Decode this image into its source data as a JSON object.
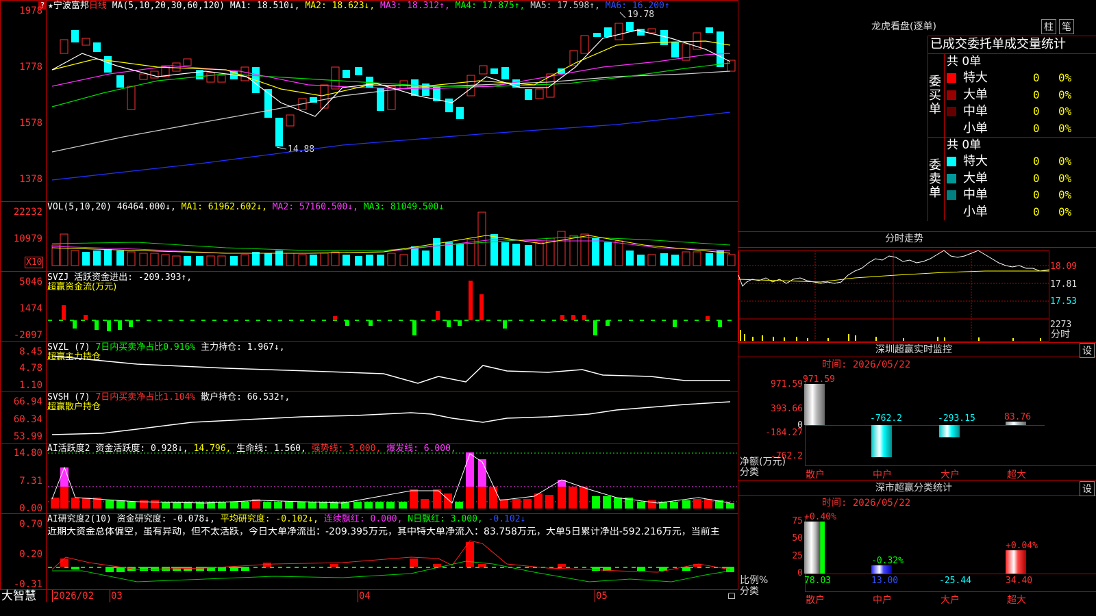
{
  "app": {
    "brand": "大智慧"
  },
  "main": {
    "question_icon": "?",
    "star": "★",
    "stock_name": "宁波富邦",
    "period": "日线",
    "ma_legend": {
      "params": "MA(5,10,20,30,60,120)",
      "ma1": "MA1: 18.510↓,",
      "ma2": "MA2: 18.623↓,",
      "ma3": "MA3: 18.312↑,",
      "ma4": "MA4: 17.875↑,",
      "ma5": "MA5: 17.598↑,",
      "ma6": "MA6: 16.200↑"
    },
    "high_label": "19.78",
    "low_label": "14.88",
    "y_labels": [
      "1978",
      "1778",
      "1578",
      "1378"
    ]
  },
  "vol": {
    "params": "VOL(5,10,20)",
    "value": "46464.000↓,",
    "ma1": "MA1: 61962.602↓,",
    "ma2": "MA2: 57160.500↓,",
    "ma3": "MA3: 81049.500↓",
    "y_labels": [
      "22232",
      "10979"
    ],
    "unit": "X10"
  },
  "svzj": {
    "line1a": "SVZJ",
    "line1b": "活跃资金进出: -209.393↑,",
    "line2": "超赢资金流(万元)",
    "y_labels": [
      "5046",
      "1474",
      "-2097"
    ]
  },
  "svzl": {
    "params": "SVZL (7)",
    "pct": "7日内买卖净占比0.916%",
    "hold": "主力持仓: 1.967↓,",
    "line2": "超赢主力持仓",
    "y_labels": [
      "8.45",
      "4.78",
      "1.10"
    ]
  },
  "svsh": {
    "params": "SVSH (7)",
    "pct": "7日内买卖净占比1.104%",
    "hold": "散户持仓: 66.532↑,",
    "line2": "超赢散户持仓",
    "y_labels": [
      "66.94",
      "60.34",
      "53.99"
    ]
  },
  "ai1": {
    "params": "AI活跃度2",
    "v1": "资金活跃度: 0.928↓,",
    "v2": "14.796,",
    "v3": "生命线: 1.560,",
    "v4": "强势线: 3.000,",
    "v5": "爆发线: 6.000,",
    "y_labels": [
      "14.80",
      "7.31",
      "0.00"
    ]
  },
  "ai2": {
    "params": "AI研究度2(10)",
    "v1": "资金研究度: -0.078↓,",
    "v2": "平均研究度: -0.102↓,",
    "v3": "连续飘红: 0.000,",
    "v4": "N日飘红: 3.000,",
    "v5": "-0.102↓",
    "comment": "近期大资金总体偏空，虽有异动，但不太活跃，今日大单净流出：-209.395万元，其中特大单净流入：83.758万元，大单5日累计净出-592.216万元，当前主",
    "y_labels": [
      "0.70",
      "0.20",
      "-0.31"
    ]
  },
  "xaxis": [
    "2026/02",
    "03",
    "04",
    "05"
  ],
  "lhb": {
    "title": "龙虎看盘(逐单)",
    "btn_bar": "柱",
    "btn_pen": "笔",
    "tabs": "已成交委托单成交量统计",
    "buy_label": "委买单",
    "sell_label": "委卖单",
    "buy_total": "共 0单",
    "sell_total": "共 0单",
    "rows": [
      {
        "name": "特大",
        "count": "0",
        "pct": "0%"
      },
      {
        "name": "大单",
        "count": "0",
        "pct": "0%"
      },
      {
        "name": "中单",
        "count": "0",
        "pct": "0%"
      },
      {
        "name": "小单",
        "count": "0",
        "pct": "0%"
      }
    ],
    "buy_colors": [
      "#ff0000",
      "#990000",
      "#660000",
      "#000000"
    ],
    "sell_colors": [
      "#00ffff",
      "#009999",
      "#008080",
      "#000000"
    ]
  },
  "intraday": {
    "title": "分时走势",
    "y_labels": [
      "18.09",
      "17.81",
      "17.53"
    ],
    "vol_label": "2273",
    "unit": "分时"
  },
  "monitor": {
    "title": "深圳超赢实时监控",
    "settings": "设",
    "time": "时间: 2026/05/22",
    "y_labels": [
      "971.59",
      "393.66",
      "0",
      "-184.27",
      "-762.2"
    ],
    "axis_title1": "净额(万元)",
    "axis_title2": "分类",
    "categories": [
      "散户",
      "中户",
      "大户",
      "超大"
    ],
    "value_labels": [
      "971.59",
      "-762.2",
      "-293.15",
      "83.76"
    ]
  },
  "classify": {
    "title": "深市超赢分类统计",
    "settings": "设",
    "time": "时间: 2026/05/22",
    "y_labels": [
      "75",
      "50",
      "25",
      "0"
    ],
    "axis_title1": "比例%",
    "axis_title2": "分类",
    "categories": [
      "散户",
      "中户",
      "大户",
      "超大"
    ],
    "top_labels": [
      "+0.40%",
      "-0.32%",
      "",
      "+0.04%"
    ],
    "bottom_values": [
      "78.03",
      "13.00",
      "-25.44",
      "34.40"
    ]
  }
}
